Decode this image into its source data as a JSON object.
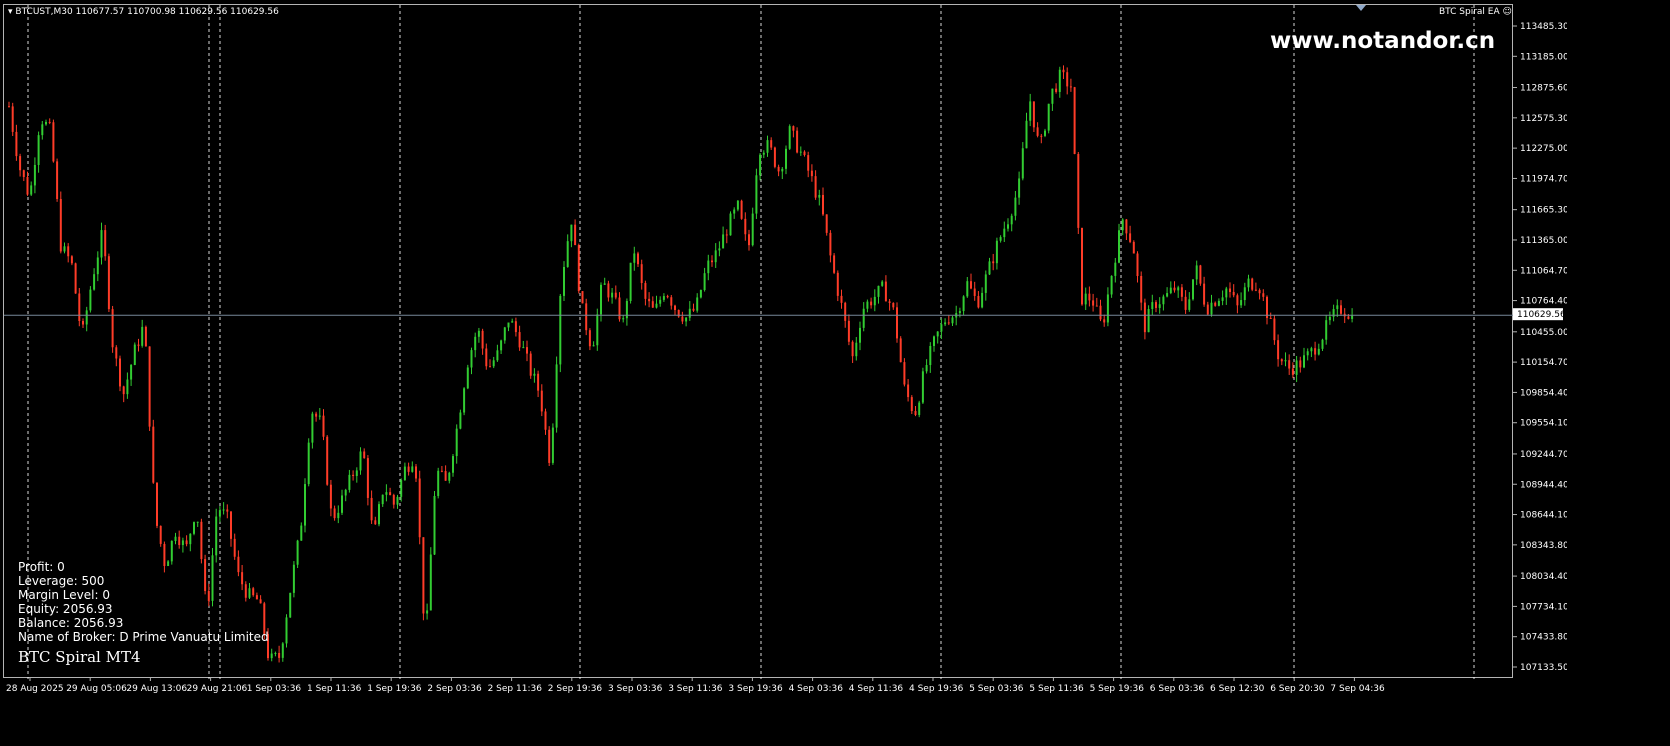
{
  "chart_header": {
    "symbol_info": "BTCUST,M30  110677.57 110700.98 110629.56 110629.56",
    "ea_name": "BTC Spiral EA",
    "watermark": "www.notandor.cn"
  },
  "account_panel": {
    "profit": "Profit: 0",
    "leverage": "Leverage: 500",
    "margin_level": "Margin Level: 0",
    "equity": "Equity: 2056.93",
    "balance": "Balance: 2056.93",
    "broker": "Name of Broker: D Prime Vanuatu Limited",
    "ea_label": "BTC Spiral MT4"
  },
  "colors": {
    "background": "#000000",
    "bull": "#32cd32",
    "bear": "#ff3c28",
    "grid": "#ffffff",
    "axis_text": "#ffffff",
    "current_price_line": "#778899"
  },
  "chart_data": {
    "type": "candlestick",
    "timeframe": "M30",
    "symbol": "BTCUST",
    "current_price": "110629.56",
    "price_ticks": [
      "113485.30",
      "113185.00",
      "112875.60",
      "112575.30",
      "112275.00",
      "111974.70",
      "111665.30",
      "111365.00",
      "111064.70",
      "110764.40",
      "110455.00",
      "110154.70",
      "109854.40",
      "109554.10",
      "109244.70",
      "108944.40",
      "108644.10",
      "108343.80",
      "108034.40",
      "107734.10",
      "107433.80",
      "107133.50"
    ],
    "time_labels": [
      "28 Aug 2025",
      "29 Aug 05:06",
      "29 Aug 13:06",
      "29 Aug 21:06",
      "1 Sep 03:36",
      "1 Sep 11:36",
      "1 Sep 19:36",
      "2 Sep 03:36",
      "2 Sep 11:36",
      "2 Sep 19:36",
      "3 Sep 03:36",
      "3 Sep 11:36",
      "3 Sep 19:36",
      "4 Sep 03:36",
      "4 Sep 11:36",
      "4 Sep 19:36",
      "5 Sep 03:36",
      "5 Sep 11:36",
      "5 Sep 19:36",
      "6 Sep 03:36",
      "6 Sep 12:30",
      "6 Sep 20:30",
      "7 Sep 04:36"
    ],
    "ylim": [
      107133.5,
      113485.3
    ],
    "close_path": [
      112700,
      112100,
      111800,
      112600,
      112450,
      111300,
      111150,
      110400,
      111000,
      111450,
      110300,
      109850,
      110250,
      110550,
      108650,
      108150,
      108500,
      108300,
      108750,
      107650,
      108750,
      108600,
      108050,
      107850,
      107800,
      107200,
      107250,
      107900,
      108500,
      109700,
      109550,
      108600,
      108800,
      109050,
      109300,
      108400,
      108950,
      108750,
      109100,
      109250,
      107350,
      109100,
      108950,
      109500,
      110150,
      110500,
      110100,
      110250,
      110600,
      110400,
      110100,
      109850,
      109150,
      110950,
      111600,
      110700,
      110300,
      110950,
      110800,
      110550,
      111300,
      110800,
      110650,
      110900,
      110700,
      110600,
      110700,
      111100,
      111250,
      111500,
      111700,
      111250,
      112300,
      112300,
      112050,
      112450,
      112250,
      112000,
      111700,
      111150,
      110700,
      110200,
      110700,
      110800,
      110900,
      110650,
      109900,
      109650,
      110100,
      110400,
      110600,
      110650,
      110950,
      110750,
      111050,
      111350,
      111600,
      111900,
      112800,
      112250,
      112800,
      113000,
      112900,
      110800,
      110800,
      110500,
      111100,
      111600,
      111300,
      110500,
      110750,
      110800,
      110900,
      110700,
      111100,
      110700,
      110800,
      110900,
      110700,
      110950,
      110950,
      110600,
      110200,
      110100,
      110150,
      110250,
      110400,
      110600,
      110700,
      110629.56
    ]
  }
}
